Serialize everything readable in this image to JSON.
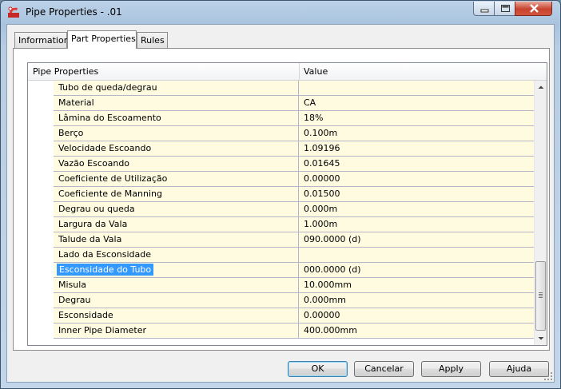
{
  "window": {
    "title": "Pipe Properties - .01"
  },
  "tabs": [
    {
      "label": "Information"
    },
    {
      "label": "Part Properties"
    },
    {
      "label": "Rules"
    }
  ],
  "grid": {
    "headers": [
      "Pipe Properties",
      "Value"
    ],
    "rows": [
      {
        "name": "Tubo de queda/degrau",
        "value": ""
      },
      {
        "name": "Material",
        "value": "CA"
      },
      {
        "name": "Lâmina do Escoamento",
        "value": "18%"
      },
      {
        "name": "Berço",
        "value": "0.100m"
      },
      {
        "name": "Velocidade Escoando",
        "value": "1.09196"
      },
      {
        "name": "Vazão Escoando",
        "value": "0.01645"
      },
      {
        "name": "Coeficiente de Utilização",
        "value": "0.00000"
      },
      {
        "name": "Coeficiente de Manning",
        "value": "0.01500"
      },
      {
        "name": "Degrau ou queda",
        "value": "0.000m"
      },
      {
        "name": "Largura da Vala",
        "value": "1.000m"
      },
      {
        "name": "Talude da Vala",
        "value": "090.0000 (d)"
      },
      {
        "name": "Lado da Esconsidade",
        "value": ""
      },
      {
        "name": "Esconsidade do Tubo",
        "value": "000.0000 (d)"
      },
      {
        "name": "Misula",
        "value": "10.000mm"
      },
      {
        "name": "Degrau",
        "value": "0.000mm"
      },
      {
        "name": "Esconsidade",
        "value": "0.00000"
      },
      {
        "name": "Inner Pipe Diameter",
        "value": "400.000mm"
      }
    ],
    "selected_row": "Esconsidade do Tubo"
  },
  "buttons": {
    "ok": "OK",
    "cancel": "Cancelar",
    "apply": "Apply",
    "help": "Ajuda"
  },
  "colors": {
    "row_background": "#fefbe0",
    "selection": "#3399ff"
  }
}
